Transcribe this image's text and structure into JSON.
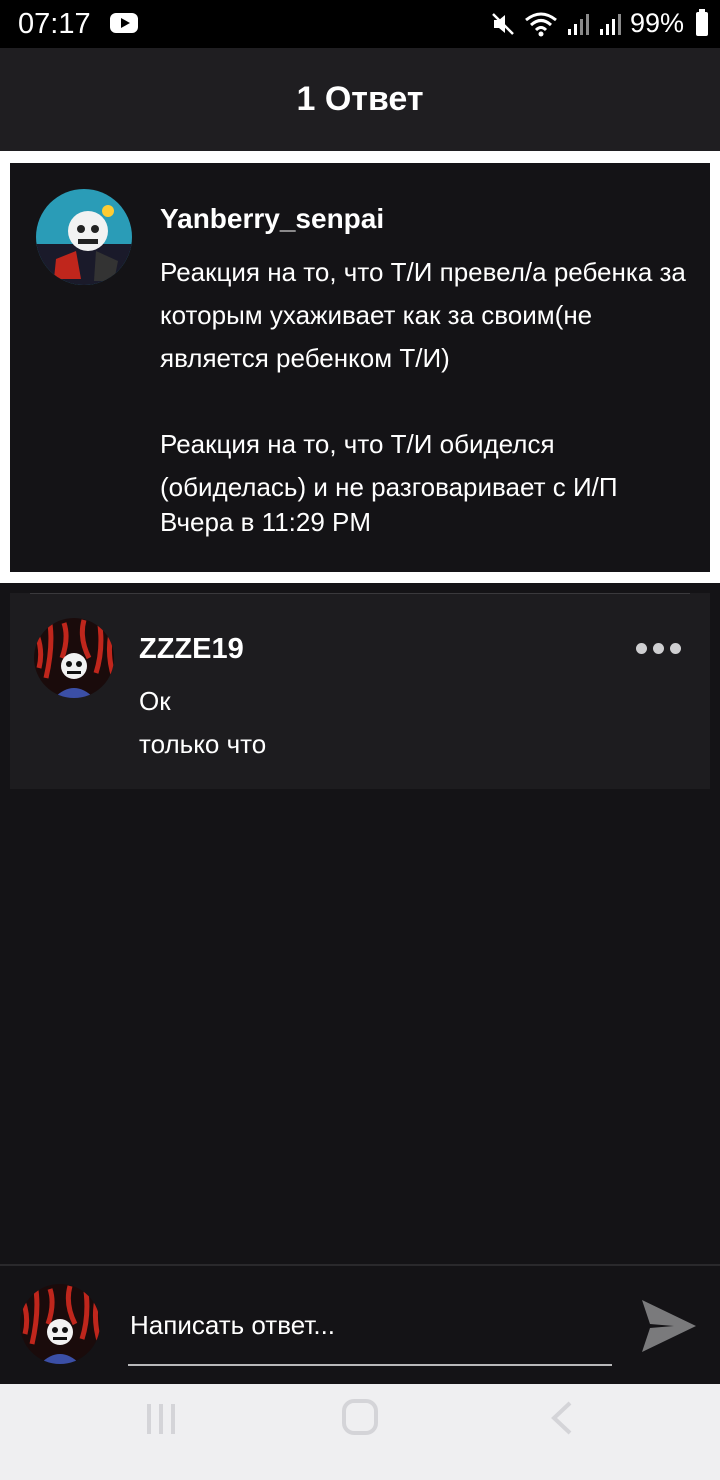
{
  "status_bar": {
    "time": "07:17",
    "battery": "99%",
    "icons": [
      "youtube-icon",
      "mute-icon",
      "wifi-icon",
      "signal-icon",
      "signal-icon",
      "battery-icon"
    ]
  },
  "header": {
    "title": "1 Ответ"
  },
  "parent_comment": {
    "author": "Yanberry_senpai",
    "text": "Реакция на то, что Т/И превел/а ребенка за которым ухаживает как за своим(не является ребенком Т/И)\n\nРеакция на то, что Т/И обиделся (обиделась) и не разговаривает с И/П",
    "time": "Вчера в 11:29 PM"
  },
  "reply": {
    "author": "ZZZE19",
    "text": "Ок",
    "time": "только что",
    "more_icon": "more-dots-icon"
  },
  "input": {
    "placeholder": "Написать ответ...",
    "send_icon": "send-icon"
  },
  "nav": {
    "icons": [
      "recents-icon",
      "home-icon",
      "back-icon"
    ]
  },
  "colors": {
    "background": "#141316",
    "header": "#1f1e21",
    "reply_card": "#1d1c1f",
    "accent_red": "#c0261c"
  }
}
